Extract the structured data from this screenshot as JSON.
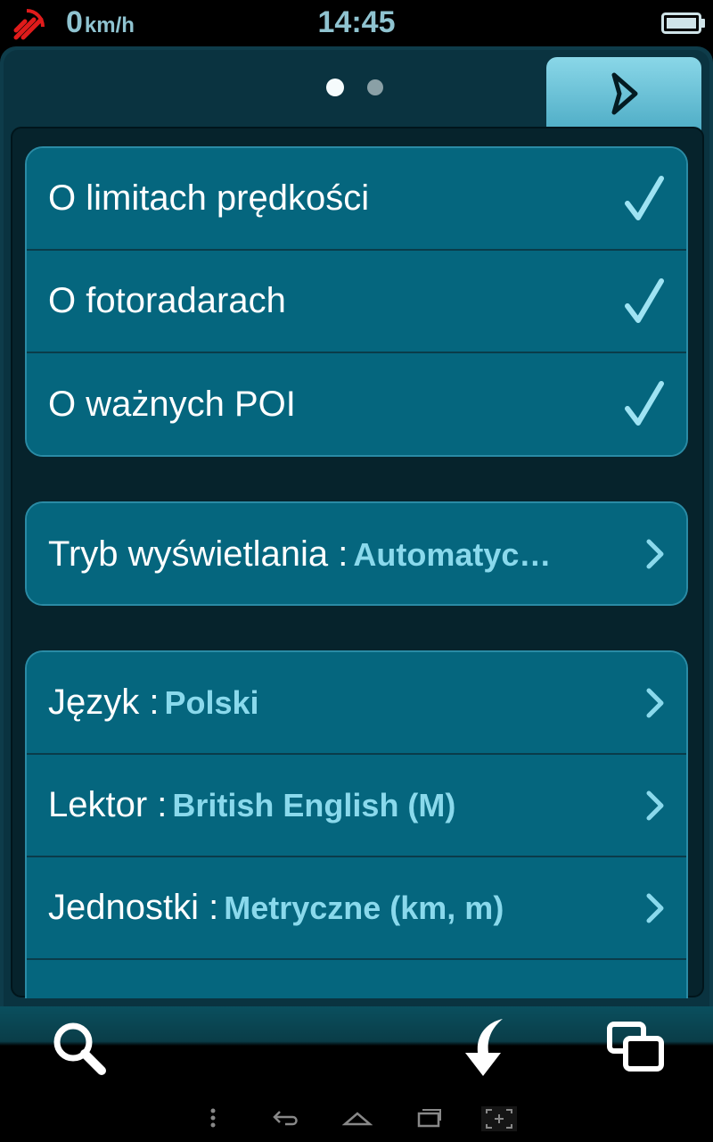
{
  "status_bar": {
    "speed_value": "0",
    "speed_unit": "km/h",
    "time": "14:45",
    "icons": {
      "gps": "gps-signal-icon",
      "battery": "battery-icon"
    }
  },
  "pager": {
    "page_count": 2,
    "active_page": 1
  },
  "next_tab": {
    "icon": "chevron-right-outline-icon"
  },
  "alerts_group": {
    "items": [
      {
        "label": "O limitach prędkości",
        "checked": true
      },
      {
        "label": "O fotoradarach",
        "checked": true
      },
      {
        "label": "O ważnych POI",
        "checked": true
      }
    ]
  },
  "display_group": {
    "items": [
      {
        "label": "Tryb wyświetlania : ",
        "value": "Automatyc…"
      }
    ]
  },
  "settings_group": {
    "items": [
      {
        "label": "Język : ",
        "value": "Polski"
      },
      {
        "label": "Lektor : ",
        "value": "British English (M)"
      },
      {
        "label": "Jednostki : ",
        "value": "Metryczne (km, m)"
      },
      {
        "label": "",
        "value": ""
      }
    ]
  },
  "bottom_toolbar": {
    "icons": [
      "search-icon",
      "back-arrow-icon",
      "windows-icon"
    ]
  },
  "colors": {
    "accent": "#8ad9ec",
    "row_bg": "#05667e",
    "panel_bg": "#06232c",
    "tab_bg": "#5fc0d6",
    "check": "#9ee3f3"
  }
}
